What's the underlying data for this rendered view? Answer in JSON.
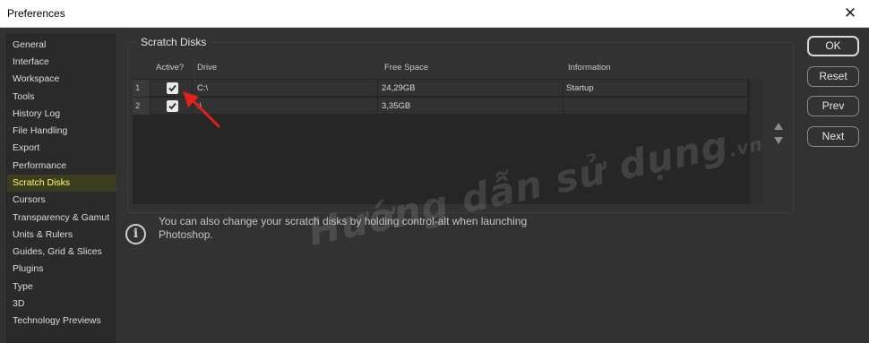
{
  "window": {
    "title": "Preferences",
    "close_glyph": "✕"
  },
  "sidebar": {
    "items": [
      {
        "label": "General"
      },
      {
        "label": "Interface"
      },
      {
        "label": "Workspace"
      },
      {
        "label": "Tools"
      },
      {
        "label": "History Log"
      },
      {
        "label": "File Handling"
      },
      {
        "label": "Export"
      },
      {
        "label": "Performance"
      },
      {
        "label": "Scratch Disks",
        "active": true
      },
      {
        "label": "Cursors"
      },
      {
        "label": "Transparency & Gamut"
      },
      {
        "label": "Units & Rulers"
      },
      {
        "label": "Guides, Grid & Slices"
      },
      {
        "label": "Plugins"
      },
      {
        "label": "Type"
      },
      {
        "label": "3D"
      },
      {
        "label": "Technology Previews"
      }
    ]
  },
  "scratch_disks": {
    "group_title": "Scratch Disks",
    "columns": {
      "active": "Active?",
      "drive": "Drive",
      "free_space": "Free Space",
      "information": "Information"
    },
    "rows": [
      {
        "index": "1",
        "active": true,
        "drive": "C:\\",
        "free_space": "24,29GB",
        "information": "Startup"
      },
      {
        "index": "2",
        "active": true,
        "drive": ":\\",
        "free_space": "3,35GB",
        "information": ""
      }
    ],
    "info_text": "You can also change your scratch disks by holding control-alt when launching Photoshop."
  },
  "buttons": {
    "ok": "OK",
    "reset": "Reset",
    "prev": "Prev",
    "next": "Next"
  },
  "watermark": {
    "text": "Hướng dẫn sử dụng",
    "suffix": ".vn"
  },
  "colors": {
    "active_sidebar_text": "#ffff66",
    "annotation_arrow": "#e0201c"
  }
}
